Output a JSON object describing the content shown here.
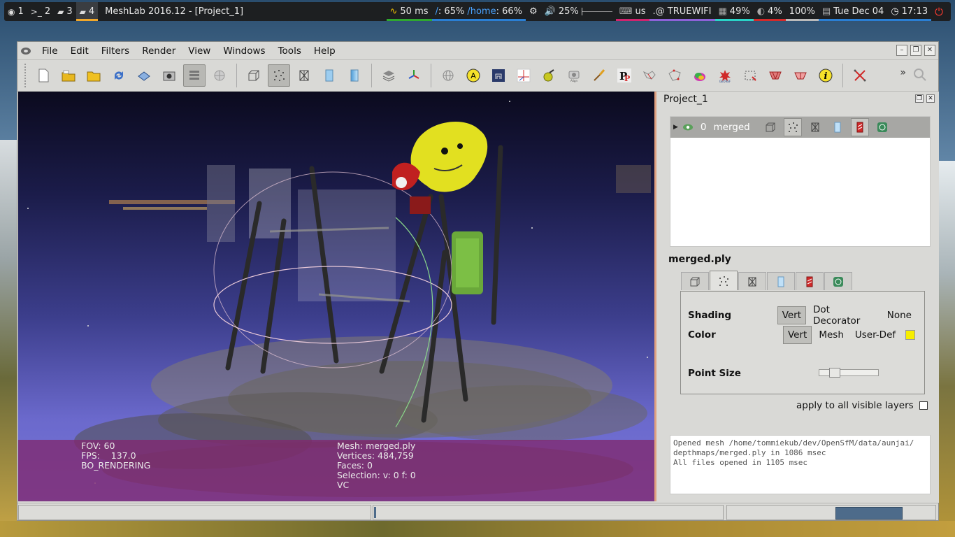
{
  "topbar": {
    "workspaces": [
      {
        "num": "1",
        "icon": "debian-icon"
      },
      {
        "num": "2",
        "icon": "terminal-icon"
      },
      {
        "num": "3",
        "icon": "briefcase-icon"
      },
      {
        "num": "4",
        "icon": "briefcase-icon",
        "active": true
      }
    ],
    "window_title": "MeshLab 2016.12 - [Project_1]",
    "ping": "50 ms",
    "disk_root_label": "/",
    "disk_root_value": ": 65%",
    "disk_home_label": "/home",
    "disk_home_value": ": 66%",
    "volume": "25%",
    "keyboard": "us",
    "wifi": ".@ TRUEWIFI",
    "memory": "49%",
    "cpu": "4%",
    "battery": "100%",
    "date": "Tue Dec 04",
    "time": "17:13"
  },
  "menu": [
    "File",
    "Edit",
    "Filters",
    "Render",
    "View",
    "Windows",
    "Tools",
    "Help"
  ],
  "viewport": {
    "fov": "FOV: 60",
    "fps": "FPS:    137.0",
    "render_mode": "BO_RENDERING",
    "mesh": "Mesh: merged.ply",
    "vertices": "Vertices: 484,759",
    "faces": "Faces: 0",
    "selection": "Selection: v: 0 f: 0",
    "color_mode": "VC"
  },
  "dock": {
    "title": "Project_1",
    "layer": {
      "index": "0",
      "name": "merged"
    },
    "mesh_title": "merged.ply",
    "shading_label": "Shading",
    "shading_options": [
      "Vert",
      "Dot Decorator",
      "None"
    ],
    "color_label": "Color",
    "color_options": [
      "Vert",
      "Mesh",
      "User-Def"
    ],
    "user_color": "#f7ee00",
    "point_size_label": "Point Size",
    "point_size_value": 0.2,
    "apply_label": "apply to all visible layers",
    "log": [
      "Opened mesh /home/tommiekub/dev/OpenSfM/data/aunjai/",
      "depthmaps/merged.ply in 1086 msec",
      "All files opened in 1105 msec"
    ]
  }
}
